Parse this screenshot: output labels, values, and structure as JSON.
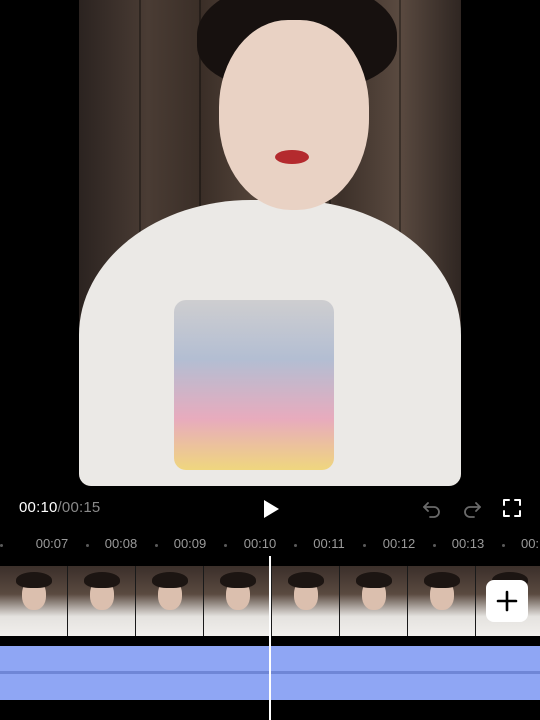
{
  "player": {
    "current_time": "00:10",
    "separator": "/",
    "total_time": "00:15"
  },
  "icons": {
    "play": "play-icon",
    "undo": "undo-icon",
    "redo": "redo-icon",
    "fullscreen": "fullscreen-icon",
    "add": "plus-icon"
  },
  "timeline": {
    "ticks": [
      "00:07",
      "00:08",
      "00:09",
      "00:10",
      "00:11",
      "00:12",
      "00:13",
      "00:"
    ],
    "video_frame_count": 8
  },
  "colors": {
    "background": "#000000",
    "audio_track": "#8fa6f4",
    "playhead": "#ffffff",
    "muted_text": "#8a8a8a"
  }
}
